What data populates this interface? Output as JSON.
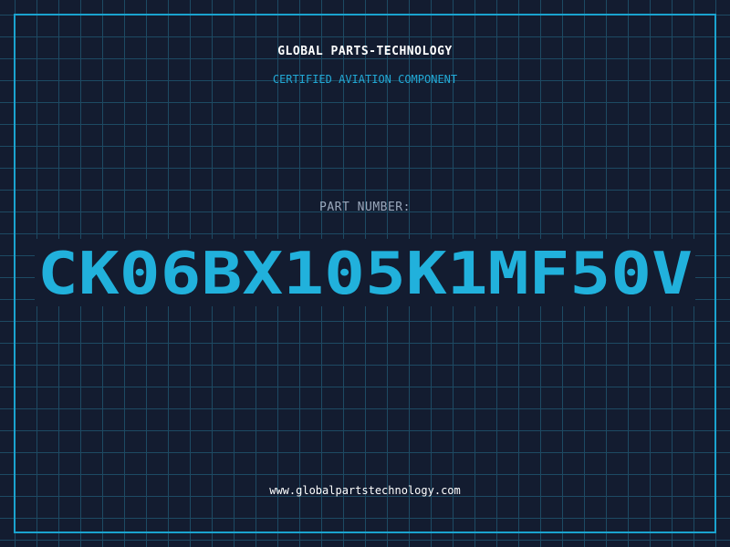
{
  "header": {
    "company": "GLOBAL PARTS-TECHNOLOGY",
    "subtitle": "CERTIFIED AVIATION COMPONENT"
  },
  "part": {
    "label": "PART NUMBER:",
    "number": "CK06BX105K1MF50V"
  },
  "footer": {
    "url": "www.globalpartstechnology.com"
  },
  "colors": {
    "background": "#131c30",
    "grid": "#1d4a63",
    "accent": "#1aa3cf",
    "part_number": "#21b1dc"
  }
}
